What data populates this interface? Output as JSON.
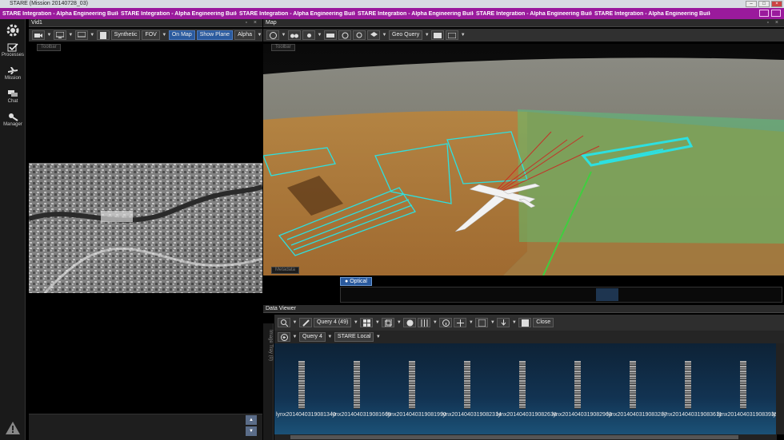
{
  "window": {
    "title": "STARE (Mission 20140728_03)"
  },
  "banner": {
    "text": "STARE Integration - Alpha Engineering Build",
    "repeat": 7
  },
  "sidebar": {
    "items": [
      {
        "label": "Processes"
      },
      {
        "label": "Mission"
      },
      {
        "label": "Chat"
      },
      {
        "label": "Manager"
      }
    ]
  },
  "vid_panel": {
    "title": "Vid1",
    "toolbar": {
      "synthetic": "Synthetic",
      "fov": "FOV",
      "on_map": "On Map",
      "show_plane": "Show Plane",
      "alpha": "Alpha"
    },
    "toolbar_pill": "Toolbar"
  },
  "map_panel": {
    "title": "Map",
    "toolbar": {
      "geo_query": "Geo Query"
    },
    "toolbar_pill": "Toolbar",
    "metadata_pill": "Metadata",
    "optical_tab": "Optical"
  },
  "data_viewer": {
    "title": "Data Viewer",
    "query_dropdown": "Query 4 (49)",
    "close_label": "Close",
    "query_tab": "Query 4",
    "source": "STARE Local",
    "side_tab": "Image Tray (0)",
    "thumbnails": [
      "lynx2014040319081340",
      "lynx2014040319081665",
      "lynx2014040319081990",
      "lynx2014040319082314",
      "lynx2014040319082638",
      "lynx2014040319082963",
      "lynx2014040319083287",
      "lynx2014040319083611",
      "lynx2014040319083935",
      "lynx"
    ]
  },
  "colors": {
    "banner": "#9a1a9c",
    "accent_blue": "#2a5a9e",
    "terrain": "#c48a3a",
    "coverage_green": "#4fcf7a",
    "flight_lines": "#2de0e0"
  }
}
